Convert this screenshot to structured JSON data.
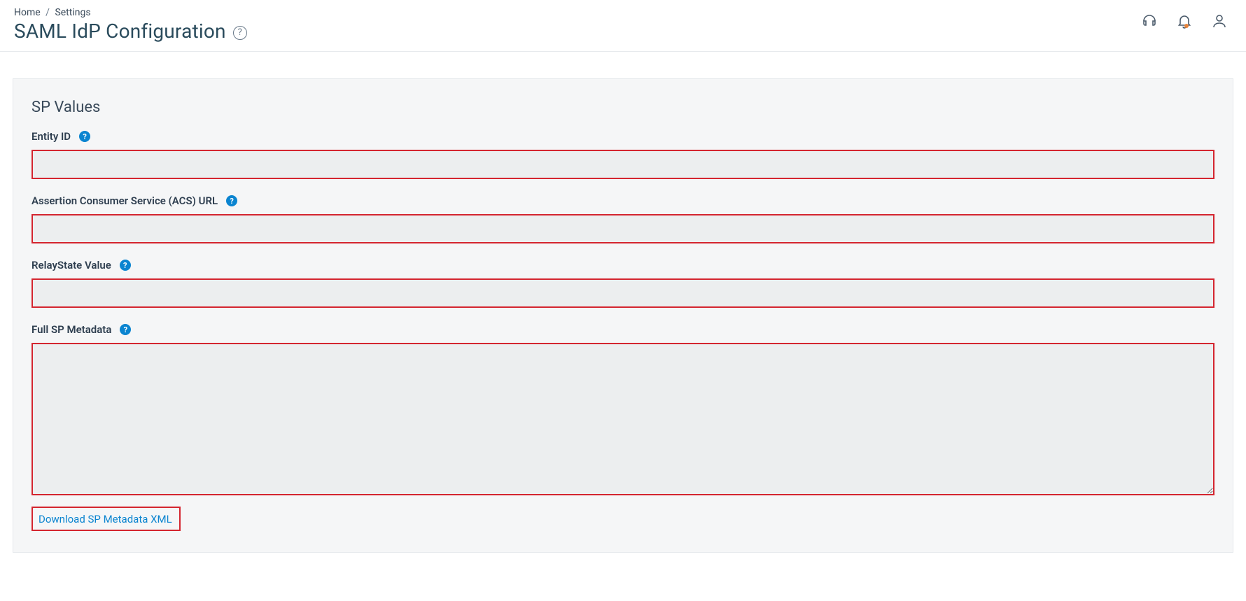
{
  "breadcrumb": {
    "home": "Home",
    "settings": "Settings"
  },
  "page_title": "SAML IdP Configuration",
  "section_title": "SP Values",
  "fields": {
    "entity_id": {
      "label": "Entity ID",
      "value": ""
    },
    "acs_url": {
      "label": "Assertion Consumer Service (ACS) URL",
      "value": ""
    },
    "relaystate": {
      "label": "RelayState Value",
      "value": ""
    },
    "metadata": {
      "label": "Full SP Metadata",
      "value": ""
    }
  },
  "download_link": "Download SP Metadata XML"
}
